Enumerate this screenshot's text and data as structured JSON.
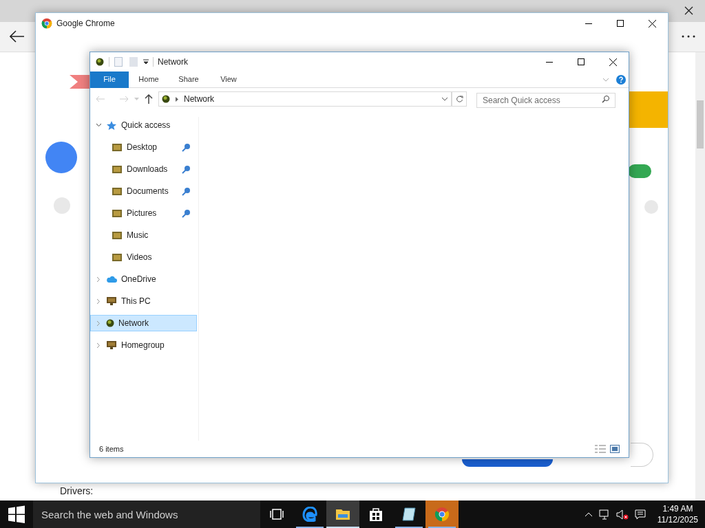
{
  "browser": {
    "page_text": "Drivers:"
  },
  "chrome_window": {
    "title": "Google Chrome"
  },
  "explorer": {
    "title": "Network",
    "ribbon_tabs": [
      {
        "label": "File",
        "selected": true
      },
      {
        "label": "Home",
        "selected": false
      },
      {
        "label": "Share",
        "selected": false
      },
      {
        "label": "View",
        "selected": false
      }
    ],
    "address": {
      "path": "Network"
    },
    "search": {
      "placeholder": "Search Quick access"
    },
    "nav": [
      {
        "label": "Quick access",
        "kind": "star",
        "expanded": true,
        "selected": false,
        "children": [
          {
            "label": "Desktop",
            "kind": "folder",
            "pinned": true,
            "selected": false
          },
          {
            "label": "Downloads",
            "kind": "folder",
            "pinned": true,
            "selected": false
          },
          {
            "label": "Documents",
            "kind": "folder",
            "pinned": true,
            "selected": false
          },
          {
            "label": "Pictures",
            "kind": "folder",
            "pinned": true,
            "selected": false
          },
          {
            "label": "Music",
            "kind": "folder",
            "pinned": false,
            "selected": false
          },
          {
            "label": "Videos",
            "kind": "folder",
            "pinned": false,
            "selected": false
          }
        ]
      },
      {
        "label": "OneDrive",
        "kind": "cloud",
        "expanded": false,
        "selected": false
      },
      {
        "label": "This PC",
        "kind": "pc",
        "expanded": false,
        "selected": false
      },
      {
        "label": "Network",
        "kind": "globe",
        "expanded": false,
        "selected": true
      },
      {
        "label": "Homegroup",
        "kind": "pc",
        "expanded": false,
        "selected": false
      }
    ],
    "status": "6 items"
  },
  "taskbar": {
    "search_placeholder": "Search the web and Windows",
    "apps": [
      {
        "kind": "taskview",
        "active": false,
        "running": false,
        "flashing": false
      },
      {
        "kind": "edge",
        "active": false,
        "running": true,
        "flashing": false
      },
      {
        "kind": "explorer",
        "active": true,
        "running": true,
        "flashing": false
      },
      {
        "kind": "store",
        "active": false,
        "running": false,
        "flashing": false
      },
      {
        "kind": "notes",
        "active": false,
        "running": true,
        "flashing": false
      },
      {
        "kind": "chrome",
        "active": false,
        "running": true,
        "flashing": true
      }
    ],
    "time": "1:49 AM",
    "date": "11/12/2025"
  }
}
